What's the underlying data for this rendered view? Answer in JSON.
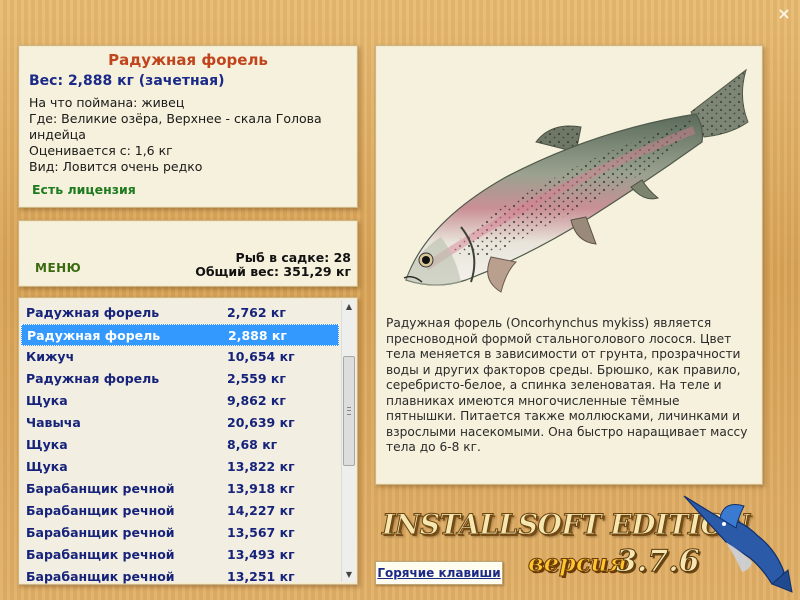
{
  "window": {
    "close_glyph": "×"
  },
  "fish_info": {
    "title": "Радужная форель",
    "weight": "Вес: 2,888 кг (зачетная)",
    "lines": [
      "На что поймана: живец",
      "Где: Великие озёра, Верхнее - скала Голова индейца",
      "Оценивается с: 1,6 кг",
      "Вид: Ловится очень редко"
    ],
    "license": "Есть лицензия"
  },
  "menu": {
    "label": "МЕНЮ",
    "fish_in_cage": "Рыб в садке: 28",
    "total_weight": "Общий вес: 351,29 кг"
  },
  "catch_list": [
    {
      "name": "Радужная форель",
      "weight": "2,762 кг",
      "selected": false
    },
    {
      "name": "Радужная форель",
      "weight": "2,888 кг",
      "selected": true
    },
    {
      "name": "Кижуч",
      "weight": "10,654 кг",
      "selected": false
    },
    {
      "name": "Радужная форель",
      "weight": "2,559 кг",
      "selected": false
    },
    {
      "name": "Щука",
      "weight": "9,862 кг",
      "selected": false
    },
    {
      "name": "Чавыча",
      "weight": "20,639 кг",
      "selected": false
    },
    {
      "name": "Щука",
      "weight": "8,68 кг",
      "selected": false
    },
    {
      "name": "Щука",
      "weight": "13,822 кг",
      "selected": false
    },
    {
      "name": "Барабанщик речной",
      "weight": "13,918 кг",
      "selected": false
    },
    {
      "name": "Барабанщик речной",
      "weight": "14,227 кг",
      "selected": false
    },
    {
      "name": "Барабанщик речной",
      "weight": "13,567 кг",
      "selected": false
    },
    {
      "name": "Барабанщик речной",
      "weight": "13,493 кг",
      "selected": false
    },
    {
      "name": "Барабанщик речной",
      "weight": "13,251 кг",
      "selected": false
    }
  ],
  "scrollbar": {
    "up_glyph": "▲",
    "down_glyph": "▼"
  },
  "description": "Радужная форель (Oncorhynchus mykiss) является пресноводной формой стальноголового лосося. Цвет тела меняется в зависимости от грунта, прозрачности воды и других факторов среды. Брюшко, как правило, серебристо-белое, а спинка зеленоватая. На теле и плавниках имеются многочисленные тёмные пятнышки. Питается также моллюсками, личинками и взрослыми насекомыми. Она быстро наращивает массу тела до 6-8 кг.",
  "brand": {
    "title": "INSTALLSOFT EDITION",
    "version_label": "версия",
    "version_number": "3.7.6"
  },
  "hotkeys_label": "Горячие клавиши",
  "colors": {
    "title_red": "#c0441c",
    "weight_blue": "#1b2a88",
    "license_green": "#1e7a1e",
    "selection": "#3399ff"
  }
}
